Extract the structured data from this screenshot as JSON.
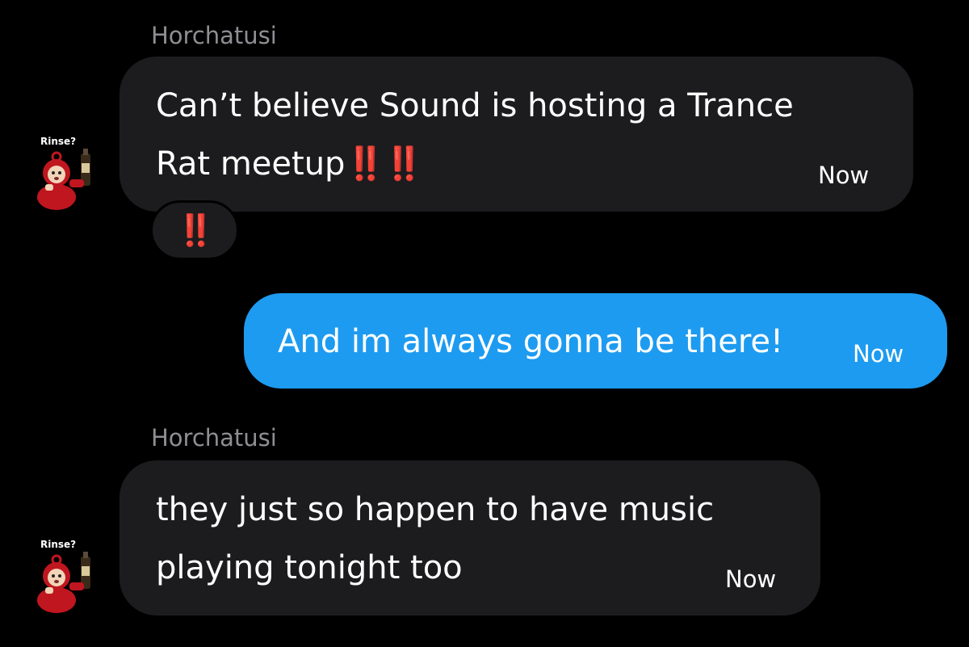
{
  "messages": [
    {
      "sender": "Horchatusi",
      "avatar_caption": "Rinse?",
      "line1": "Can’t believe Sound is hosting a Trance",
      "line2": "Rat meetup",
      "line2_emoji": "‼️‼️",
      "time": "Now",
      "reaction": "‼️"
    },
    {
      "text": "And im always gonna be there!",
      "time": "Now"
    },
    {
      "sender": "Horchatusi",
      "avatar_caption": "Rinse?",
      "line1": "they just so happen to have music",
      "line2": "playing tonight too",
      "time": "Now"
    }
  ],
  "colors": {
    "background": "#000000",
    "incoming_bubble": "#1c1c1e",
    "outgoing_bubble": "#1d9bf0",
    "sender_name": "#8e8e93",
    "emoji_red": "#e01e1e"
  },
  "icons": {
    "avatar": "teletubby-avatar-icon"
  }
}
